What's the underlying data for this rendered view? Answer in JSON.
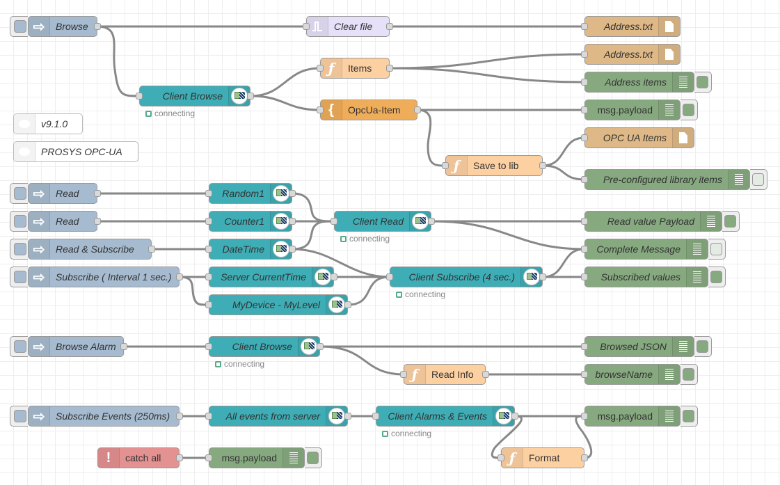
{
  "app": "Node-RED flow editor",
  "colors": {
    "inject": "#a6bbcf",
    "opcua": "#3fadb5",
    "debug": "#87a980",
    "function": "#fdd0a2",
    "template": "#f0ad59",
    "file": "#deb887",
    "trigger": "#e6e0f8",
    "catch": "#e49191",
    "wire": "#888888",
    "status_connecting": "#55aa88"
  },
  "comments": [
    {
      "id": "c1",
      "label": "v9.1.0",
      "icon": "comment-icon"
    },
    {
      "id": "c2",
      "label": "PROSYS OPC-UA",
      "icon": "comment-icon"
    }
  ],
  "nodes": {
    "browse_inject": {
      "label": "Browse",
      "type": "inject",
      "icon": "arrow-right-icon"
    },
    "clear_file": {
      "label": "Clear file",
      "type": "trigger",
      "icon": "trigger-pulse-icon"
    },
    "address_txt_1": {
      "label": "Address.txt",
      "type": "file",
      "icon": "file-icon"
    },
    "client_browse_1": {
      "label": "Client Browse",
      "type": "opcua-browser",
      "icon": "opc-ua-logo-icon",
      "status": "connecting"
    },
    "items_fn": {
      "label": "Items",
      "type": "function",
      "icon": "function-icon"
    },
    "opcua_item": {
      "label": "OpcUa-Item",
      "type": "template",
      "icon": "template-brace-icon"
    },
    "address_txt_2": {
      "label": "Address.txt",
      "type": "file",
      "icon": "file-icon"
    },
    "address_items": {
      "label": "Address items",
      "type": "debug",
      "icon": "debug-list-icon",
      "active": true
    },
    "msg_payload_1": {
      "label": "msg.payload",
      "type": "debug",
      "icon": "debug-list-icon",
      "active": true
    },
    "save_to_lib": {
      "label": "Save to lib",
      "type": "function",
      "icon": "function-icon"
    },
    "opc_ua_items": {
      "label": "OPC UA Items",
      "type": "file",
      "icon": "file-icon"
    },
    "preconf_lib": {
      "label": "Pre-configured library items",
      "type": "debug",
      "icon": "debug-list-icon",
      "active": false
    },
    "read_1": {
      "label": "Read",
      "type": "inject",
      "icon": "arrow-right-icon"
    },
    "random1": {
      "label": "Random1",
      "type": "opcua-item",
      "icon": "opc-ua-logo-icon"
    },
    "read_2": {
      "label": "Read",
      "type": "inject",
      "icon": "arrow-right-icon"
    },
    "counter1": {
      "label": "Counter1",
      "type": "opcua-item",
      "icon": "opc-ua-logo-icon"
    },
    "read_subscribe": {
      "label": "Read & Subscribe",
      "type": "inject",
      "icon": "arrow-right-icon"
    },
    "datetime": {
      "label": "DateTime",
      "type": "opcua-item",
      "icon": "opc-ua-logo-icon"
    },
    "subscribe_interval": {
      "label": "Subscribe ( Interval 1 sec.)",
      "type": "inject",
      "icon": "arrow-right-icon"
    },
    "server_currenttime": {
      "label": "Server CurrentTime",
      "type": "opcua-item",
      "icon": "opc-ua-logo-icon"
    },
    "mydevice_mylevel": {
      "label": "MyDevice - MyLevel",
      "type": "opcua-item",
      "icon": "opc-ua-logo-icon"
    },
    "client_read": {
      "label": "Client Read",
      "type": "opcua-client",
      "icon": "opc-ua-logo-icon",
      "status": "connecting"
    },
    "client_subscribe": {
      "label": "Client Subscribe (4 sec.)",
      "type": "opcua-client",
      "icon": "opc-ua-logo-icon",
      "status": "connecting"
    },
    "read_value_payload": {
      "label": "Read value Payload",
      "type": "debug",
      "icon": "debug-list-icon",
      "active": true
    },
    "complete_message": {
      "label": "Complete Message",
      "type": "debug",
      "icon": "debug-list-icon",
      "active": false
    },
    "subscribed_values": {
      "label": "Subscribed values",
      "type": "debug",
      "icon": "debug-list-icon",
      "active": true
    },
    "browse_alarm": {
      "label": "Browse Alarm",
      "type": "inject",
      "icon": "arrow-right-icon"
    },
    "client_browse_2": {
      "label": "Client Browse",
      "type": "opcua-browser",
      "icon": "opc-ua-logo-icon",
      "status": "connecting"
    },
    "read_info": {
      "label": "Read Info",
      "type": "function",
      "icon": "function-icon"
    },
    "browsed_json": {
      "label": "Browsed JSON",
      "type": "debug",
      "icon": "debug-list-icon",
      "active": true
    },
    "browsename": {
      "label": "browseName",
      "type": "debug",
      "icon": "debug-list-icon",
      "active": true
    },
    "subscribe_events": {
      "label": "Subscribe Events (250ms)",
      "type": "inject",
      "icon": "arrow-right-icon"
    },
    "all_events": {
      "label": "All events from server",
      "type": "opcua-event",
      "icon": "opc-ua-logo-icon"
    },
    "client_alarms_events": {
      "label": "Client Alarms & Events",
      "type": "opcua-client",
      "icon": "opc-ua-logo-icon",
      "status": "connecting"
    },
    "format_fn": {
      "label": "Format",
      "type": "function",
      "icon": "function-icon"
    },
    "msg_payload_2": {
      "label": "msg.payload",
      "type": "debug",
      "icon": "debug-list-icon",
      "active": true
    },
    "catch_all": {
      "label": "catch all",
      "type": "catch",
      "icon": "exclamation-icon"
    },
    "msg_payload_3": {
      "label": "msg.payload",
      "type": "debug",
      "icon": "debug-list-icon",
      "active": true
    }
  }
}
